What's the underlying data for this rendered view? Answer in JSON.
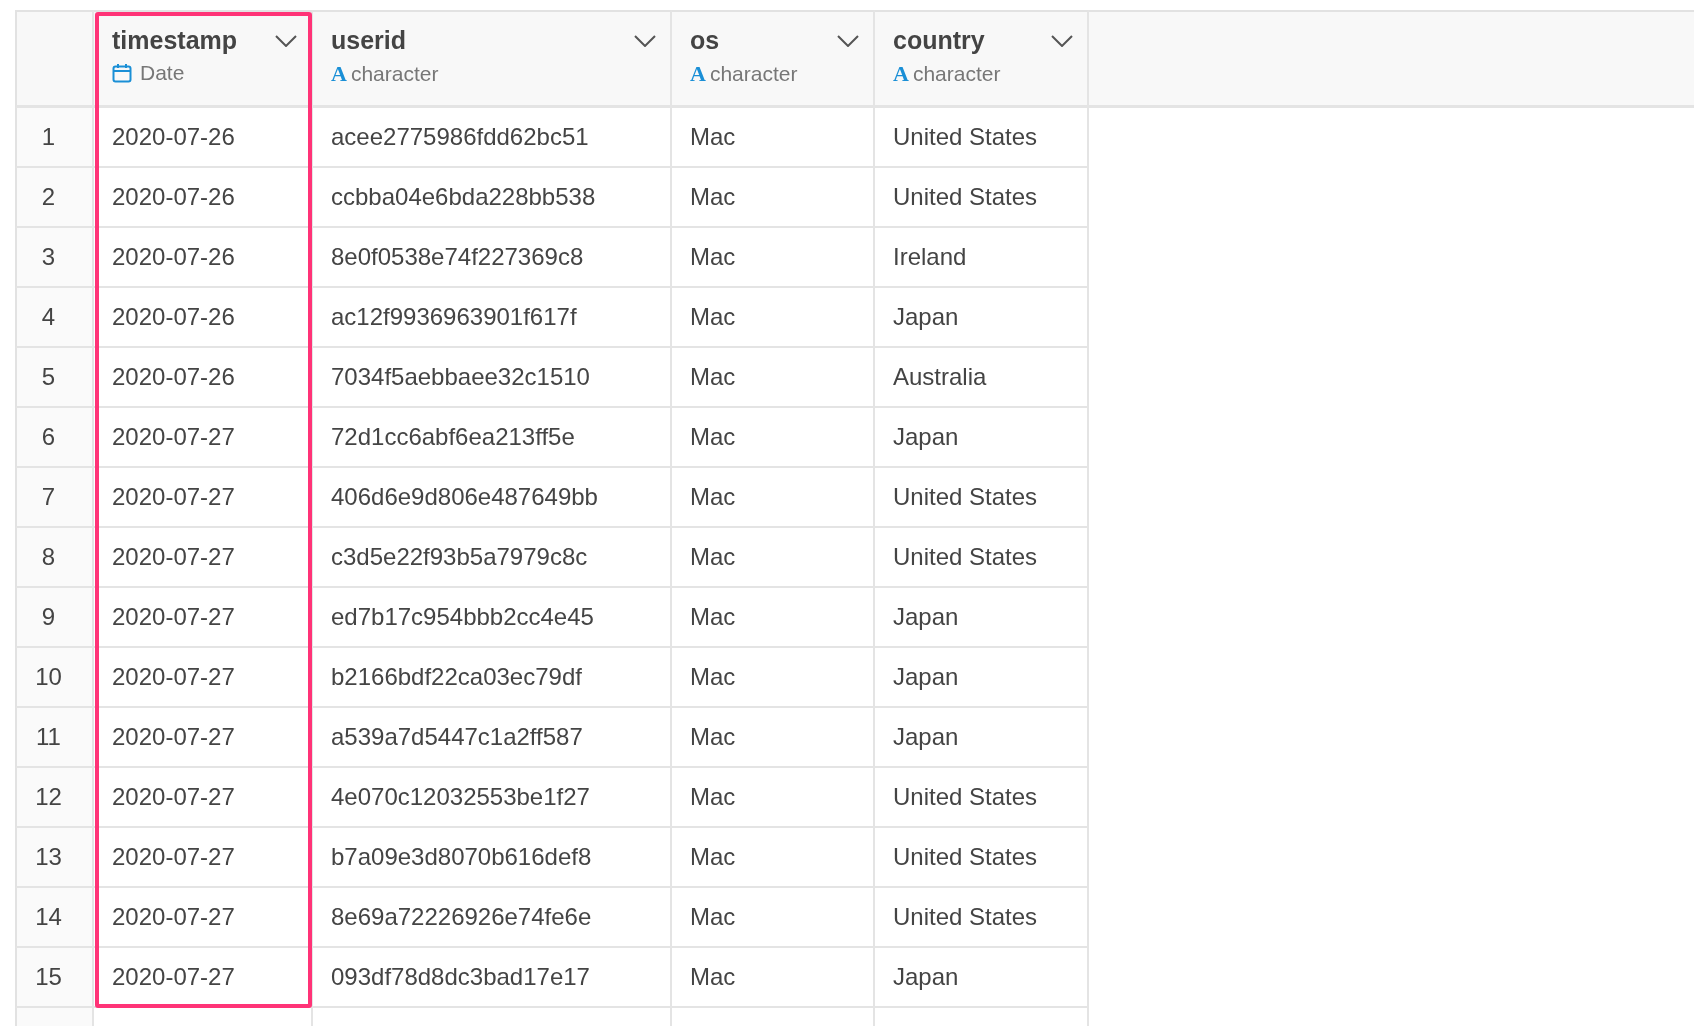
{
  "columns": [
    {
      "name": "timestamp",
      "kind": "date",
      "type_label": "Date",
      "selected": true
    },
    {
      "name": "userid",
      "kind": "character",
      "type_glyph": "A",
      "type_label": "character",
      "selected": false
    },
    {
      "name": "os",
      "kind": "character",
      "type_glyph": "A",
      "type_label": "character",
      "selected": false
    },
    {
      "name": "country",
      "kind": "character",
      "type_glyph": "A",
      "type_label": "character",
      "selected": false
    }
  ],
  "rows": [
    {
      "index": "1",
      "cells": [
        "2020-07-26",
        "acee2775986fdd62bc51",
        "Mac",
        "United States"
      ]
    },
    {
      "index": "2",
      "cells": [
        "2020-07-26",
        "ccbba04e6bda228bb538",
        "Mac",
        "United States"
      ]
    },
    {
      "index": "3",
      "cells": [
        "2020-07-26",
        "8e0f0538e74f227369c8",
        "Mac",
        "Ireland"
      ]
    },
    {
      "index": "4",
      "cells": [
        "2020-07-26",
        "ac12f9936963901f617f",
        "Mac",
        "Japan"
      ]
    },
    {
      "index": "5",
      "cells": [
        "2020-07-26",
        "7034f5aebbaee32c1510",
        "Mac",
        "Australia"
      ]
    },
    {
      "index": "6",
      "cells": [
        "2020-07-27",
        "72d1cc6abf6ea213ff5e",
        "Mac",
        "Japan"
      ]
    },
    {
      "index": "7",
      "cells": [
        "2020-07-27",
        "406d6e9d806e487649bb",
        "Mac",
        "United States"
      ]
    },
    {
      "index": "8",
      "cells": [
        "2020-07-27",
        "c3d5e22f93b5a7979c8c",
        "Mac",
        "United States"
      ]
    },
    {
      "index": "9",
      "cells": [
        "2020-07-27",
        "ed7b17c954bbb2cc4e45",
        "Mac",
        "Japan"
      ]
    },
    {
      "index": "10",
      "cells": [
        "2020-07-27",
        "b2166bdf22ca03ec79df",
        "Mac",
        "Japan"
      ]
    },
    {
      "index": "11",
      "cells": [
        "2020-07-27",
        "a539a7d5447c1a2ff587",
        "Mac",
        "Japan"
      ]
    },
    {
      "index": "12",
      "cells": [
        "2020-07-27",
        "4e070c12032553be1f27",
        "Mac",
        "United States"
      ]
    },
    {
      "index": "13",
      "cells": [
        "2020-07-27",
        "b7a09e3d8070b616def8",
        "Mac",
        "United States"
      ]
    },
    {
      "index": "14",
      "cells": [
        "2020-07-27",
        "8e69a72226926e74fe6e",
        "Mac",
        "United States"
      ]
    },
    {
      "index": "15",
      "cells": [
        "2020-07-27",
        "093df78d8dc3bad17e17",
        "Mac",
        "Japan"
      ]
    }
  ]
}
